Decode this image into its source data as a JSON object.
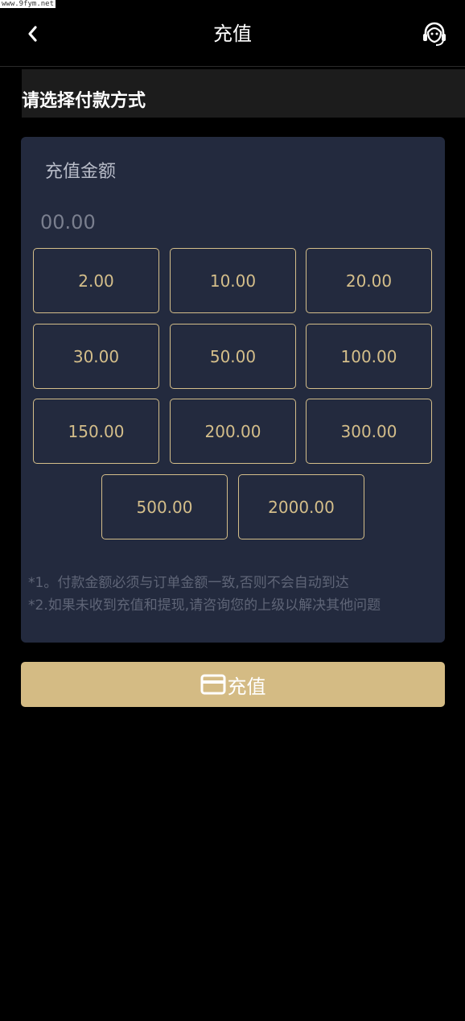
{
  "watermark": "www.9fym.net",
  "header": {
    "title": "充值",
    "back_icon": "chevron-left-icon",
    "support_icon": "headset-icon"
  },
  "section": {
    "title": "请选择付款方式"
  },
  "recharge": {
    "amount_label": "充值金额",
    "amount_placeholder": "00.00",
    "amounts": [
      "2.00",
      "10.00",
      "20.00",
      "30.00",
      "50.00",
      "100.00",
      "150.00",
      "200.00",
      "300.00",
      "500.00",
      "2000.00"
    ],
    "notes": [
      "*1。付款金额必须与订单金额一致,否则不会自动到达",
      "*2.如果未收到充值和提现,请咨询您的上级以解决其他问题"
    ]
  },
  "submit": {
    "label": "充值",
    "icon": "credit-card-icon"
  },
  "colors": {
    "background": "#000000",
    "card": "#232a3e",
    "accent": "#d4be8a",
    "button": "#d4bb84"
  }
}
